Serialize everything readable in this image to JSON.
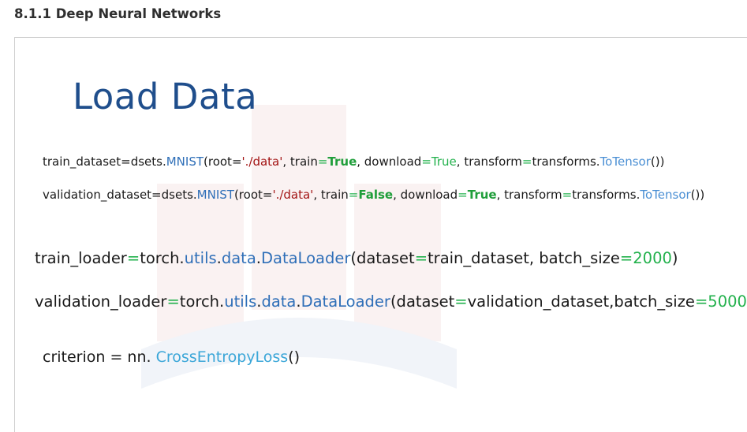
{
  "header": {
    "section_title": "8.1.1 Deep Neural Networks"
  },
  "slide": {
    "title": "Load Data",
    "line1": {
      "p1": "train_dataset=dsets.",
      "p2": "MNIST",
      "p3": "(root=",
      "p4": "'./data'",
      "p5": ", train",
      "p6": "=",
      "p7": "True",
      "p8": ", download",
      "p9": "=",
      "p10": "True",
      "p11": ", transform",
      "p12": "=",
      "p13": "transforms.",
      "p14": "ToTensor",
      "p15": "())"
    },
    "line2": {
      "p1": "validation_dataset=dsets.",
      "p2": "MNIST",
      "p3": "(root=",
      "p4": "'./data'",
      "p5": ", train",
      "p6": "=",
      "p7": "False",
      "p8": ", download",
      "p9": "=",
      "p10": "True",
      "p11": ", transform",
      "p12": "=",
      "p13": "transforms.",
      "p14": "ToTensor",
      "p15": "())"
    },
    "line3": {
      "p1": "train_loader",
      "p2": "=",
      "p3": "torch.",
      "p4": "utils",
      "p5": ".",
      "p6": "data",
      "p7": ".",
      "p8": "DataLoader",
      "p9": "(dataset",
      "p10": "=",
      "p11": "train_dataset, batch_size",
      "p12": "=",
      "p13": "2000",
      "p14": ")"
    },
    "line4": {
      "p1": "validation_loader",
      "p2": "=",
      "p3": "torch.",
      "p4": "utils",
      "p5": ".",
      "p6": "data",
      "p7": ".",
      "p8": "DataLoader",
      "p9": "(dataset",
      "p10": "=",
      "p11": "validation_dataset,batch_size",
      "p12": "=",
      "p13": "5000",
      "p14": ")"
    },
    "line5": {
      "p1": "criterion = nn. ",
      "p2": "CrossEntropyLoss",
      "p3": "()"
    }
  }
}
